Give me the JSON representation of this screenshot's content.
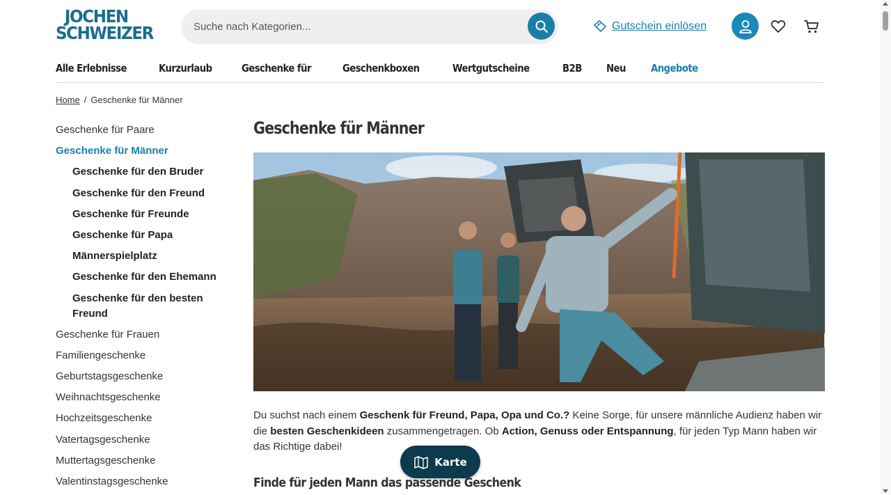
{
  "brand": {
    "logo_line1": "JOCHEN",
    "logo_line2": "SCHWEIZER",
    "accent_color": "#1a7fa7",
    "dark_color": "#0d3a4d"
  },
  "search": {
    "placeholder": "Suche nach Kategorien...",
    "icon": "search-icon"
  },
  "header": {
    "voucher_label": "Gutschein einlösen",
    "voucher_icon": "ticket-icon",
    "account_icon": "user-icon",
    "wishlist_icon": "heart-icon",
    "cart_icon": "cart-icon"
  },
  "nav": {
    "items": [
      "Alle Erlebnisse",
      "Kurzurlaub",
      "Geschenke für",
      "Geschenkboxen",
      "Wertgutscheine",
      "B2B",
      "Neu",
      "Angebote"
    ]
  },
  "breadcrumb": {
    "home": "Home",
    "separator": "/",
    "current": "Geschenke für Männer"
  },
  "sidebar": {
    "items": [
      "Geschenke für Paare",
      "Geschenke für Männer",
      "Geschenke für den Bruder",
      "Geschenke für den Freund",
      "Geschenke für Freunde",
      "Geschenke für Papa",
      "Männerspielplatz",
      "Geschenke für den Ehemann",
      "Geschenke für den besten Freund",
      "Geschenke für Frauen",
      "Familiengeschenke",
      "Geburtstagsgeschenke",
      "Weihnachtsgeschenke",
      "Hochzeitsgeschenke",
      "Vatertagsgeschenke",
      "Muttertagsgeschenke",
      "Valentinstagsgeschenke"
    ]
  },
  "main": {
    "title": "Geschenke für Männer",
    "intro": {
      "p1": "Du suchst nach einem ",
      "b1": "Geschenk für Freund, Papa, Opa und Co.?",
      "p2": " Keine Sorge, für unsere männliche Audienz haben wir die ",
      "b2": "besten Geschenkideen",
      "p3": " zusammengetragen. Ob ",
      "b3": "Action, Genuss oder Entspannung",
      "p4": ", für jeden Typ Mann haben wir das Richtige dabei!"
    },
    "subheading": "Finde für jeden Mann das passende Geschenk"
  },
  "map_button": {
    "label": "Karte",
    "icon": "map-icon"
  }
}
